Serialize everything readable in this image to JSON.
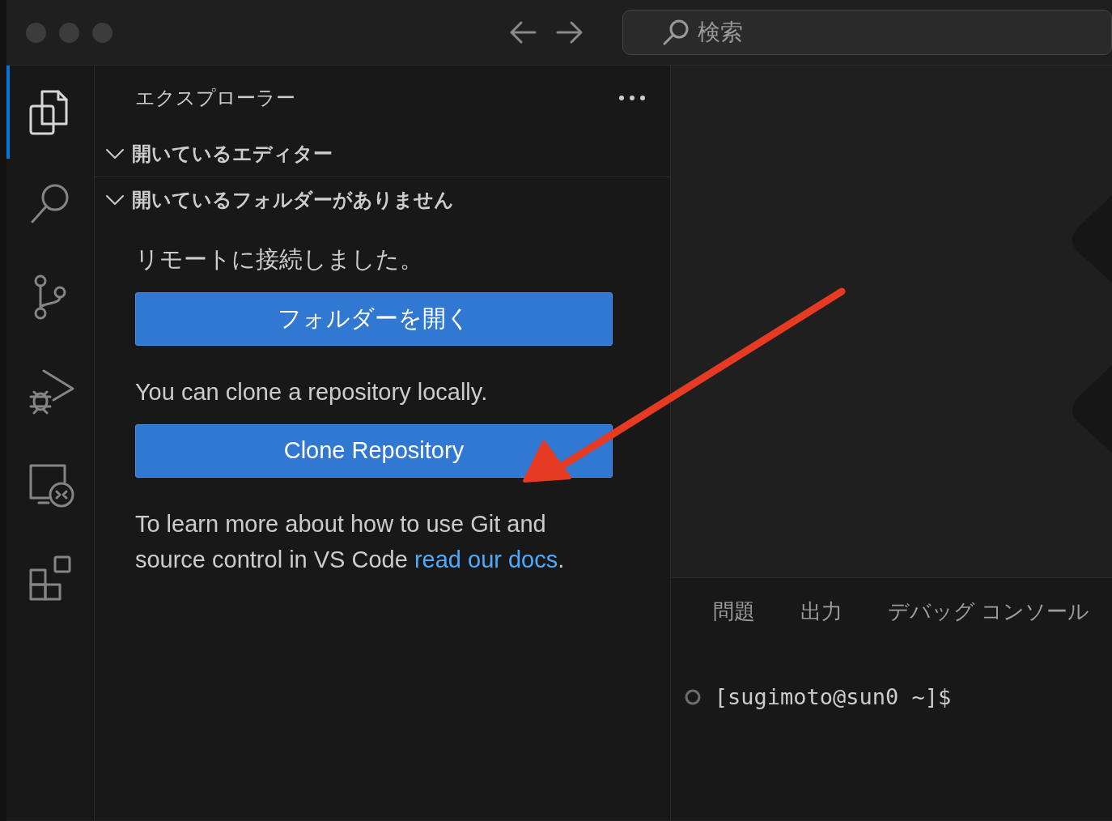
{
  "title_bar": {
    "search_placeholder": "検索"
  },
  "activity_bar": [
    {
      "kind": "explorer",
      "selected": true
    },
    {
      "kind": "search",
      "selected": false
    },
    {
      "kind": "source-control",
      "selected": false
    },
    {
      "kind": "run-debug",
      "selected": false
    },
    {
      "kind": "remote",
      "selected": false
    },
    {
      "kind": "extensions",
      "selected": false
    }
  ],
  "sidebar": {
    "title": "エクスプローラー",
    "sections": [
      {
        "label": "開いているエディター",
        "expanded": true
      },
      {
        "label": "開いているフォルダーがありません",
        "expanded": true
      }
    ],
    "content": [
      {
        "kind": "text",
        "text": "リモートに接続しました。"
      },
      {
        "kind": "button",
        "text": "フォルダーを開く"
      },
      {
        "kind": "text",
        "text": "You can clone a repository locally."
      },
      {
        "kind": "button",
        "text": "Clone Repository"
      },
      {
        "kind": "text",
        "text": "To learn more about how to use Git and source control in VS Code ",
        "link": "read our docs",
        "after": "."
      }
    ]
  },
  "panel": {
    "tabs": [
      {
        "label": "問題",
        "selected": false
      },
      {
        "label": "出力",
        "selected": false
      },
      {
        "label": "デバッグ コンソール",
        "selected": false
      }
    ],
    "terminal_line": "[sugimoto@sun0 ~]$"
  }
}
